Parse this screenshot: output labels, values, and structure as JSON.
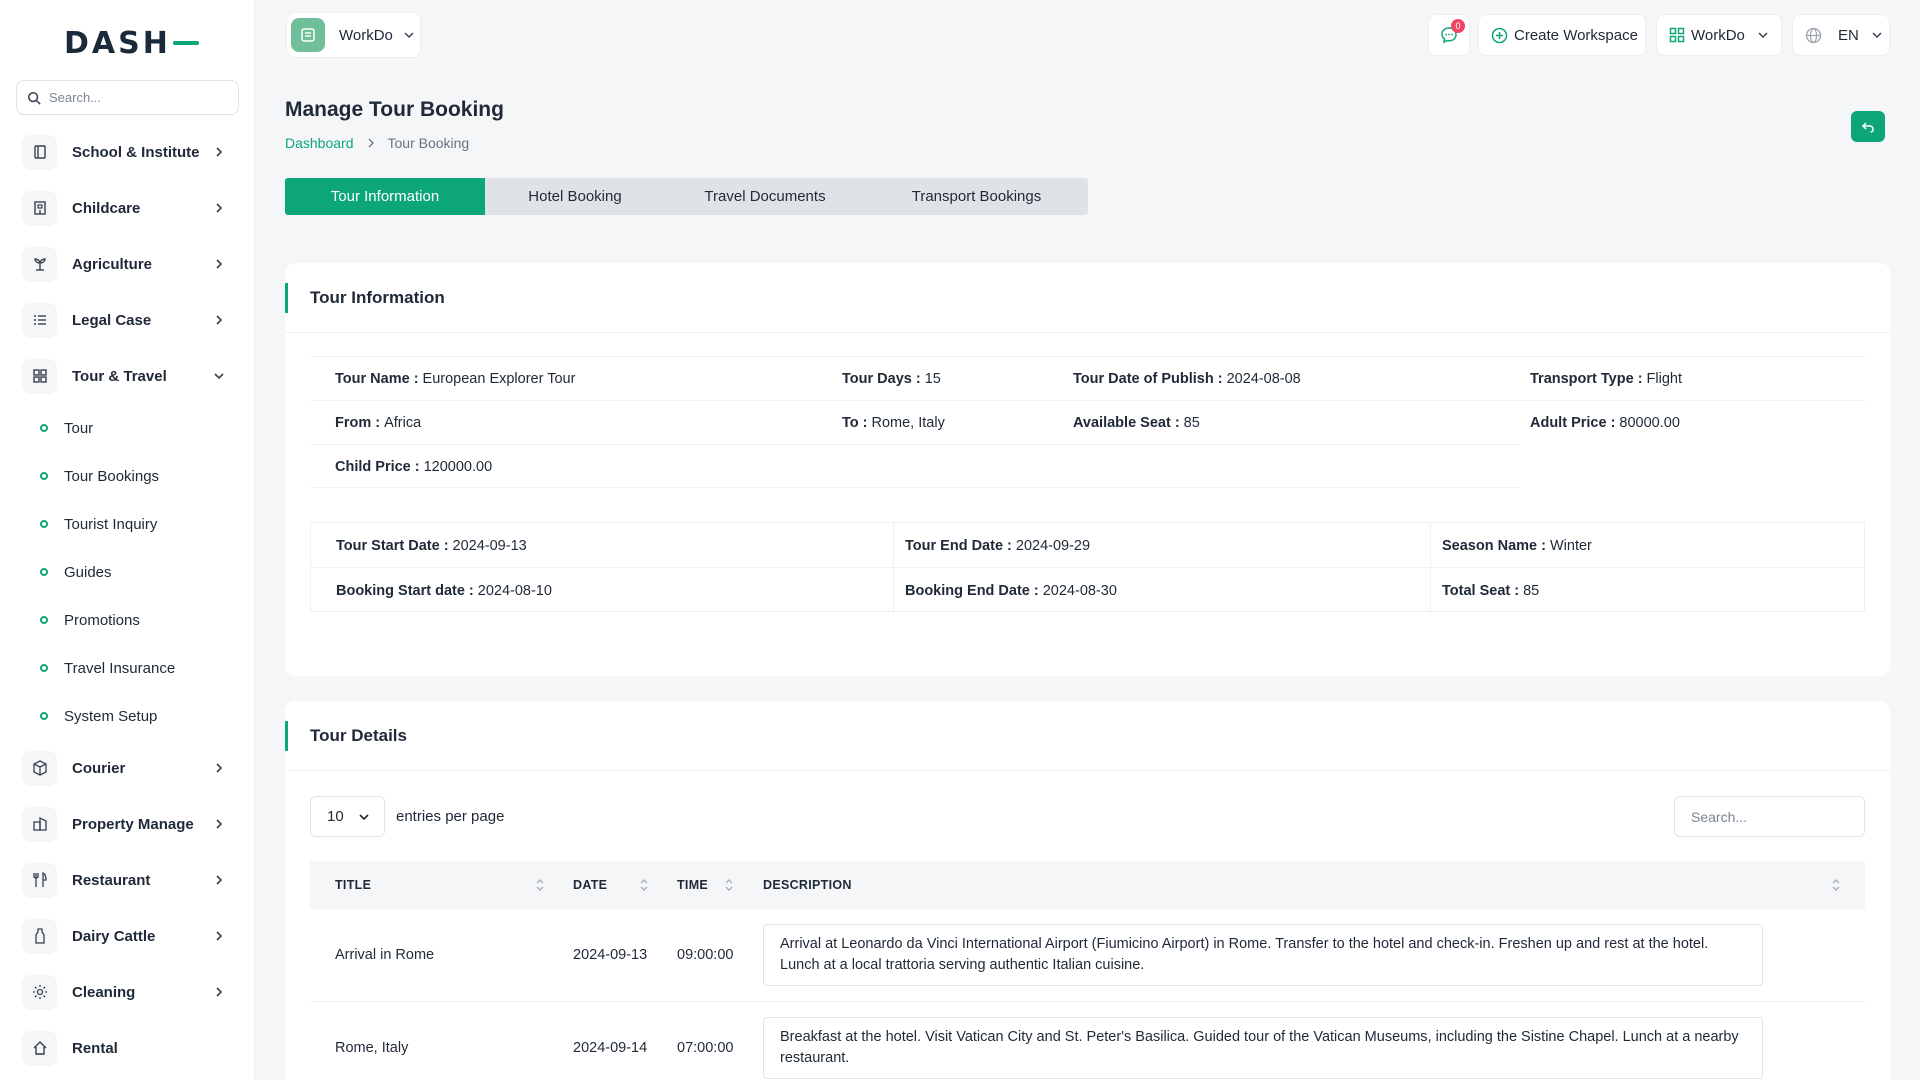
{
  "sidebar": {
    "logo": "DASH",
    "search_placeholder": "Search...",
    "items": [
      {
        "label": "School & Institute",
        "icon": "book-icon"
      },
      {
        "label": "Childcare",
        "icon": "building-icon"
      },
      {
        "label": "Agriculture",
        "icon": "plant-icon"
      },
      {
        "label": "Legal Case",
        "icon": "list-icon"
      },
      {
        "label": "Tour & Travel",
        "icon": "grid-icon",
        "expanded": true
      },
      {
        "label": "Courier",
        "icon": "box-icon"
      },
      {
        "label": "Property Manage",
        "icon": "property-icon"
      },
      {
        "label": "Restaurant",
        "icon": "cutlery-icon"
      },
      {
        "label": "Dairy Cattle",
        "icon": "bottle-icon"
      },
      {
        "label": "Cleaning",
        "icon": "sparkle-icon"
      },
      {
        "label": "Rental",
        "icon": "home-icon"
      }
    ],
    "sub_items": [
      "Tour",
      "Tour Bookings",
      "Tourist Inquiry",
      "Guides",
      "Promotions",
      "Travel Insurance",
      "System Setup"
    ]
  },
  "topbar": {
    "workspace_name": "WorkDo",
    "notification_count": "0",
    "create_workspace": "Create Workspace",
    "workspace_dropdown": "WorkDo",
    "language": "EN"
  },
  "page": {
    "title": "Manage Tour Booking",
    "breadcrumb_home": "Dashboard",
    "breadcrumb_current": "Tour Booking"
  },
  "tabs": [
    "Tour Information",
    "Hotel Booking",
    "Travel Documents",
    "Transport Bookings"
  ],
  "tour_info": {
    "heading": "Tour Information",
    "tour_name_label": "Tour Name :",
    "tour_name": "European Explorer Tour",
    "tour_days_label": "Tour Days :",
    "tour_days": "15",
    "publish_label": "Tour Date of Publish :",
    "publish": "2024-08-08",
    "transport_label": "Transport Type :",
    "transport": "Flight",
    "from_label": "From :",
    "from": "Africa",
    "to_label": "To :",
    "to": "Rome, Italy",
    "seat_label": "Available Seat :",
    "seat": "85",
    "adult_label": "Adult Price :",
    "adult": "80000.00",
    "child_label": "Child Price :",
    "child": "120000.00",
    "start_label": "Tour Start Date :",
    "start": "2024-09-13",
    "end_label": "Tour End Date :",
    "end": "2024-09-29",
    "season_label": "Season Name :",
    "season": "Winter",
    "bstart_label": "Booking Start date :",
    "bstart": "2024-08-10",
    "bend_label": "Booking End Date :",
    "bend": "2024-08-30",
    "total_label": "Total Seat :",
    "total": "85"
  },
  "tour_details": {
    "heading": "Tour Details",
    "per_page": "10",
    "entries_text": "entries per page",
    "search_placeholder": "Search...",
    "columns": [
      "TITLE",
      "DATE",
      "TIME",
      "DESCRIPTION"
    ],
    "rows": [
      {
        "title": "Arrival in Rome",
        "date": "2024-09-13",
        "time": "09:00:00",
        "description": "Arrival at Leonardo da Vinci International Airport (Fiumicino Airport) in Rome. Transfer to the hotel and check-in. Freshen up and rest at the hotel. Lunch at a local trattoria serving authentic Italian cuisine."
      },
      {
        "title": "Rome, Italy",
        "date": "2024-09-14",
        "time": "07:00:00",
        "description": "Breakfast at the hotel. Visit Vatican City and St. Peter's Basilica. Guided tour of the Vatican Museums, including the Sistine Chapel. Lunch at a nearby restaurant."
      }
    ]
  },
  "colors": {
    "accent": "#0ca678",
    "badge": "#ef4565"
  }
}
